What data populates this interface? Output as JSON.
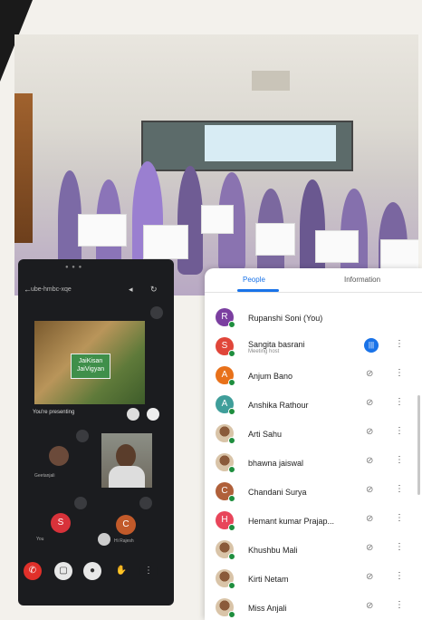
{
  "slide": {
    "box_text": "JaiKisan\nJaiVigyan"
  },
  "phone": {
    "meet_code": "ube-hmbc-xqe",
    "presenting_caption": "You're presenting",
    "tile_labels": [
      "Geetanjali",
      "You",
      "Hi Rajesh"
    ]
  },
  "panel": {
    "tabs": {
      "people": "People",
      "information": "Information"
    },
    "participants": [
      {
        "name": "Rupanshi Soni (You)",
        "initial": "R",
        "color": "#7b3fa0",
        "sub": "",
        "state": "none"
      },
      {
        "name": "Sangita basrani",
        "initial": "S",
        "color": "#e0463a",
        "sub": "Meeting host",
        "state": "speaking"
      },
      {
        "name": "Anjum Bano",
        "initial": "A",
        "color": "#e8711a",
        "sub": "",
        "state": "muted"
      },
      {
        "name": "Anshika Rathour",
        "initial": "A",
        "color": "#3f9e9a",
        "sub": "",
        "state": "muted"
      },
      {
        "name": "Arti Sahu",
        "initial": "",
        "color": "",
        "sub": "",
        "state": "muted",
        "photo": true
      },
      {
        "name": "bhawna jaiswal",
        "initial": "",
        "color": "",
        "sub": "",
        "state": "muted",
        "photo": true
      },
      {
        "name": "Chandani Surya",
        "initial": "C",
        "color": "#b0603a",
        "sub": "",
        "state": "muted"
      },
      {
        "name": "Hemant kumar Prajap...",
        "initial": "H",
        "color": "#e8455a",
        "sub": "",
        "state": "muted"
      },
      {
        "name": "Khushbu Mali",
        "initial": "",
        "color": "",
        "sub": "",
        "state": "muted",
        "photo": true
      },
      {
        "name": "Kirti Netam",
        "initial": "",
        "color": "",
        "sub": "",
        "state": "muted",
        "photo": true
      },
      {
        "name": "Miss Anjali",
        "initial": "",
        "color": "",
        "sub": "",
        "state": "muted",
        "photo": true
      }
    ]
  }
}
